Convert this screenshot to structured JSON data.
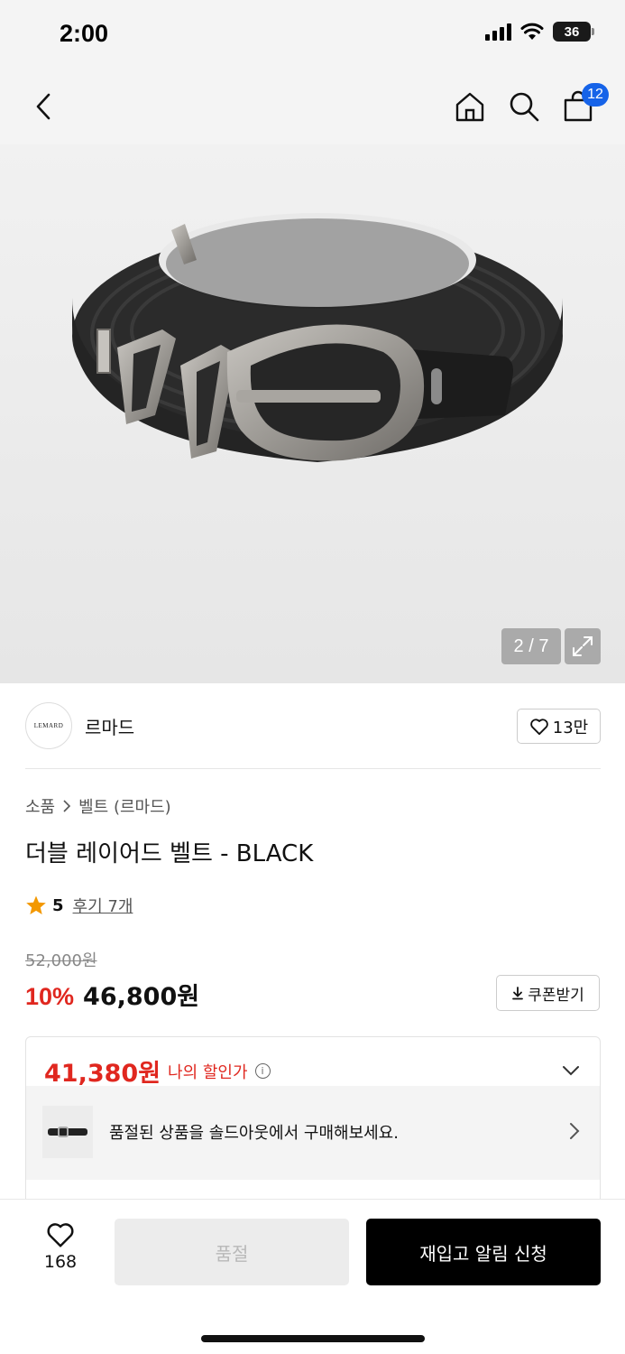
{
  "status": {
    "time": "2:00",
    "battery": "36"
  },
  "header": {
    "cart_count": "12"
  },
  "gallery": {
    "counter": "2 / 7"
  },
  "brand": {
    "logo_text": "LEMARD",
    "name": "르마드",
    "likes": "13만"
  },
  "breadcrumb": {
    "category": "소품",
    "subcategory": "벨트 (르마드)"
  },
  "product": {
    "title": "더블 레이어드 벨트 - BLACK",
    "rating": "5",
    "reviews": "후기 7개",
    "original_price": "52,000원",
    "discount": "10%",
    "sale_price": "46,800원",
    "coupon_label": "쿠폰받기"
  },
  "my_price": {
    "amount": "41,380원",
    "label": "나의 할인가",
    "soldout_notice": "품절된 상품을 솔드아웃에서 구매해보세요."
  },
  "bottom": {
    "wish_count": "168",
    "soldout_label": "품절",
    "restock_label": "재입고 알림 신청"
  },
  "colors": {
    "accent_red": "#e0271f",
    "badge_blue": "#1663e8",
    "star": "#f39800"
  }
}
